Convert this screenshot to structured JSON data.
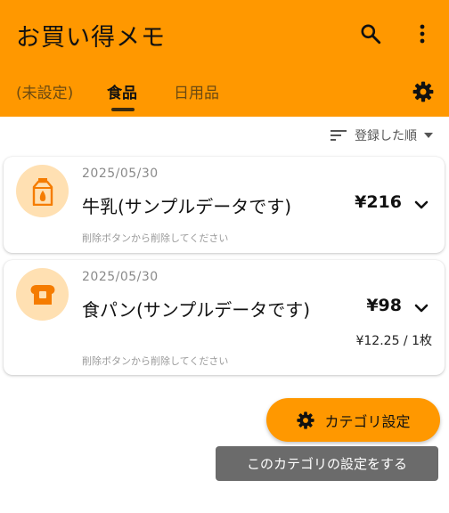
{
  "app": {
    "title": "お買い得メモ"
  },
  "toolbar": {
    "search_icon": "search-icon",
    "more_icon": "more-vert-icon",
    "settings_icon": "gear-icon"
  },
  "tabs": [
    {
      "label": "(未設定)",
      "active": false
    },
    {
      "label": "食品",
      "active": true
    },
    {
      "label": "日用品",
      "active": false
    }
  ],
  "sort": {
    "icon": "sort-icon",
    "label": "登録した順",
    "dropdown_icon": "caret-down-icon"
  },
  "items": [
    {
      "icon": "milk-carton-icon",
      "date": "2025/05/30",
      "name": "牛乳(サンプルデータです)",
      "price": "¥216",
      "unit_price": "",
      "hint": "削除ボタンから削除してください"
    },
    {
      "icon": "bread-icon",
      "date": "2025/05/30",
      "name": "食パン(サンプルデータです)",
      "price": "¥98",
      "unit_price": "¥12.25 / 1枚",
      "hint": "削除ボタンから削除してください"
    }
  ],
  "fab": {
    "icon": "gear-icon",
    "label": "カテゴリ設定"
  },
  "tooltip": {
    "text": "このカテゴリの設定をする"
  },
  "colors": {
    "primary": "#FF9800",
    "icon_circle": "#FFE0B2",
    "tooltip_bg": "#6b6b6b"
  }
}
